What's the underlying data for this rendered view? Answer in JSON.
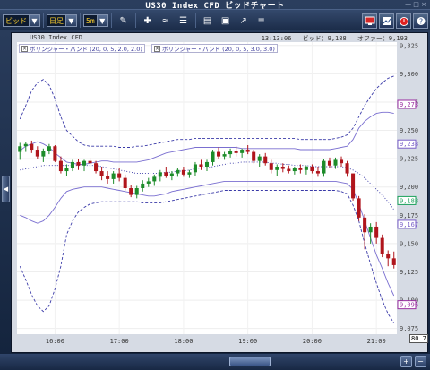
{
  "window": {
    "title": "US30 Index CFD ビッドチャート",
    "controls": "— □ ×"
  },
  "toolbar": {
    "price_type": "ビッド",
    "chart_type": "日足",
    "timeframe": "5m",
    "icons": [
      "pen-icon",
      "cross-icon",
      "wave-icon",
      "bars-icon",
      "briefcase-icon",
      "image-icon",
      "trend-icon",
      "list-icon",
      "monitor-icon",
      "chart-icon",
      "alarm-icon",
      "help-icon"
    ]
  },
  "header": {
    "symbol": "US30 Index CFD",
    "time": "13:13:06",
    "bid_label": "ビッド：",
    "bid": "9,188",
    "offer_label": "オファー：",
    "offer": "9,193"
  },
  "legend": {
    "item1": "ボリンジャー・バンド (20, 0, 5, 2.0, 2.0)",
    "item2": "ボリンジャー・バンド (20, 0, 5, 3.0, 3.0)"
  },
  "y_axis": {
    "ticks": [
      "9,325",
      "9,300",
      "9,275",
      "9,250",
      "9,225",
      "9,200",
      "9,175",
      "9,150",
      "9,125",
      "9,100",
      "9,075"
    ],
    "markers": [
      {
        "label": "9,273",
        "value": 9273,
        "color": "#9a2da0"
      },
      {
        "label": "9,238",
        "value": 9238,
        "color": "#7a5fc8"
      },
      {
        "label": "9,188",
        "value": 9188,
        "color": "#1aa05a"
      },
      {
        "label": "9,167",
        "value": 9167,
        "color": "#7a5fc8"
      },
      {
        "label": "9,096",
        "value": 9096,
        "color": "#9a2da0"
      }
    ],
    "corner_value": "80.7"
  },
  "x_axis": {
    "ticks": [
      "16:00",
      "17:00",
      "18:00",
      "19:00",
      "20:00",
      "21:00"
    ]
  },
  "chart_data": {
    "type": "candlestick",
    "ylim": [
      9070,
      9328
    ],
    "up_color": "#1d8c2a",
    "down_color": "#b0151c",
    "band_color": "#7a6fd0",
    "outer_band_color": "#3a3aa8",
    "candles": [
      [
        9231,
        9239,
        9224,
        9236
      ],
      [
        9236,
        9240,
        9231,
        9238
      ],
      [
        9238,
        9241,
        9230,
        9233
      ],
      [
        9233,
        9236,
        9225,
        9227
      ],
      [
        9227,
        9234,
        9222,
        9232
      ],
      [
        9232,
        9238,
        9229,
        9236
      ],
      [
        9236,
        9237,
        9222,
        9223
      ],
      [
        9223,
        9227,
        9212,
        9214
      ],
      [
        9214,
        9220,
        9210,
        9217
      ],
      [
        9217,
        9224,
        9214,
        9222
      ],
      [
        9222,
        9225,
        9215,
        9219
      ],
      [
        9219,
        9224,
        9214,
        9223
      ],
      [
        9223,
        9226,
        9218,
        9221
      ],
      [
        9221,
        9223,
        9212,
        9214
      ],
      [
        9214,
        9218,
        9206,
        9210
      ],
      [
        9210,
        9214,
        9203,
        9207
      ],
      [
        9207,
        9214,
        9203,
        9212
      ],
      [
        9212,
        9217,
        9205,
        9208
      ],
      [
        9208,
        9211,
        9197,
        9199
      ],
      [
        9199,
        9202,
        9191,
        9193
      ],
      [
        9193,
        9201,
        9190,
        9199
      ],
      [
        9199,
        9206,
        9196,
        9203
      ],
      [
        9203,
        9208,
        9200,
        9205
      ],
      [
        9205,
        9211,
        9201,
        9209
      ],
      [
        9209,
        9215,
        9205,
        9213
      ],
      [
        9213,
        9218,
        9208,
        9210
      ],
      [
        9210,
        9214,
        9206,
        9212
      ],
      [
        9212,
        9217,
        9209,
        9215
      ],
      [
        9215,
        9218,
        9209,
        9211
      ],
      [
        9211,
        9215,
        9208,
        9213
      ],
      [
        9213,
        9222,
        9210,
        9220
      ],
      [
        9220,
        9224,
        9215,
        9218
      ],
      [
        9218,
        9224,
        9214,
        9222
      ],
      [
        9222,
        9233,
        9219,
        9231
      ],
      [
        9231,
        9235,
        9225,
        9227
      ],
      [
        9227,
        9231,
        9224,
        9229
      ],
      [
        9229,
        9234,
        9226,
        9232
      ],
      [
        9232,
        9236,
        9227,
        9230
      ],
      [
        9230,
        9234,
        9226,
        9233
      ],
      [
        9233,
        9237,
        9229,
        9231
      ],
      [
        9231,
        9233,
        9221,
        9223
      ],
      [
        9223,
        9229,
        9218,
        9227
      ],
      [
        9227,
        9230,
        9219,
        9221
      ],
      [
        9221,
        9224,
        9212,
        9215
      ],
      [
        9215,
        9220,
        9210,
        9218
      ],
      [
        9218,
        9221,
        9213,
        9216
      ],
      [
        9216,
        9219,
        9212,
        9214
      ],
      [
        9214,
        9218,
        9211,
        9217
      ],
      [
        9217,
        9220,
        9212,
        9215
      ],
      [
        9215,
        9219,
        9211,
        9218
      ],
      [
        9218,
        9220,
        9212,
        9214
      ],
      [
        9214,
        9218,
        9209,
        9212
      ],
      [
        9212,
        9225,
        9209,
        9223
      ],
      [
        9223,
        9226,
        9217,
        9219
      ],
      [
        9219,
        9226,
        9216,
        9224
      ],
      [
        9224,
        9227,
        9218,
        9221
      ],
      [
        9221,
        9223,
        9209,
        9212
      ],
      [
        9212,
        9212,
        9188,
        9190
      ],
      [
        9190,
        9192,
        9170,
        9173
      ],
      [
        9173,
        9176,
        9145,
        9160
      ],
      [
        9160,
        9168,
        9150,
        9165
      ],
      [
        9165,
        9169,
        9150,
        9155
      ],
      [
        9155,
        9158,
        9138,
        9141
      ],
      [
        9141,
        9144,
        9130,
        9137
      ],
      [
        9137,
        9143,
        9128,
        9131
      ]
    ],
    "upper2": [
      9232,
      9236,
      9238,
      9240,
      9238,
      9235,
      9230,
      9226,
      9222,
      9221,
      9220,
      9220,
      9221,
      9222,
      9223,
      9223,
      9222,
      9222,
      9222,
      9222,
      9222,
      9223,
      9224,
      9226,
      9228,
      9230,
      9231,
      9232,
      9233,
      9234,
      9235,
      9235,
      9235,
      9235,
      9235,
      9235,
      9235,
      9235,
      9234,
      9234,
      9234,
      9234,
      9234,
      9234,
      9234,
      9234,
      9234,
      9234,
      9233,
      9233,
      9233,
      9233,
      9233,
      9233,
      9234,
      9235,
      9236,
      9242,
      9252,
      9258,
      9262,
      9265,
      9266,
      9266,
      9265
    ],
    "middle": [
      9215,
      9216,
      9217,
      9218,
      9219,
      9219,
      9219,
      9219,
      9219,
      9219,
      9219,
      9219,
      9219,
      9219,
      9218,
      9217,
      9216,
      9215,
      9214,
      9213,
      9212,
      9212,
      9212,
      9212,
      9212,
      9213,
      9213,
      9214,
      9214,
      9215,
      9216,
      9217,
      9217,
      9218,
      9219,
      9220,
      9221,
      9221,
      9222,
      9222,
      9222,
      9222,
      9222,
      9221,
      9221,
      9220,
      9220,
      9219,
      9219,
      9219,
      9218,
      9218,
      9218,
      9218,
      9218,
      9218,
      9217,
      9215,
      9212,
      9208,
      9203,
      9198,
      9193,
      9187,
      9180
    ],
    "lower2": [
      9175,
      9173,
      9170,
      9168,
      9170,
      9175,
      9182,
      9190,
      9196,
      9198,
      9199,
      9200,
      9200,
      9200,
      9200,
      9199,
      9198,
      9197,
      9196,
      9195,
      9194,
      9193,
      9192,
      9192,
      9193,
      9194,
      9196,
      9197,
      9198,
      9199,
      9200,
      9201,
      9202,
      9203,
      9204,
      9205,
      9205,
      9205,
      9205,
      9205,
      9205,
      9205,
      9205,
      9205,
      9205,
      9205,
      9205,
      9205,
      9205,
      9205,
      9205,
      9205,
      9205,
      9205,
      9205,
      9204,
      9203,
      9198,
      9185,
      9170,
      9155,
      9140,
      9128,
      9115,
      9104
    ],
    "upper3": [
      9260,
      9272,
      9285,
      9292,
      9295,
      9290,
      9278,
      9262,
      9250,
      9245,
      9240,
      9237,
      9236,
      9236,
      9236,
      9236,
      9236,
      9235,
      9235,
      9235,
      9236,
      9236,
      9237,
      9238,
      9239,
      9240,
      9241,
      9242,
      9242,
      9242,
      9243,
      9243,
      9243,
      9243,
      9243,
      9243,
      9243,
      9243,
      9243,
      9243,
      9243,
      9243,
      9243,
      9243,
      9243,
      9243,
      9243,
      9243,
      9242,
      9242,
      9242,
      9242,
      9242,
      9242,
      9243,
      9244,
      9246,
      9252,
      9262,
      9272,
      9280,
      9287,
      9292,
      9296,
      9298
    ],
    "lower3": [
      9130,
      9118,
      9105,
      9095,
      9090,
      9095,
      9110,
      9130,
      9158,
      9170,
      9178,
      9182,
      9185,
      9186,
      9187,
      9187,
      9187,
      9187,
      9187,
      9187,
      9187,
      9186,
      9186,
      9186,
      9186,
      9187,
      9188,
      9189,
      9190,
      9191,
      9192,
      9193,
      9194,
      9195,
      9196,
      9197,
      9197,
      9197,
      9197,
      9197,
      9197,
      9197,
      9197,
      9197,
      9197,
      9197,
      9197,
      9197,
      9197,
      9197,
      9197,
      9197,
      9197,
      9197,
      9197,
      9196,
      9194,
      9184,
      9170,
      9150,
      9132,
      9115,
      9100,
      9088,
      9080
    ],
    "x_tick_candle_index": [
      6,
      17,
      28,
      39,
      50,
      61
    ]
  }
}
